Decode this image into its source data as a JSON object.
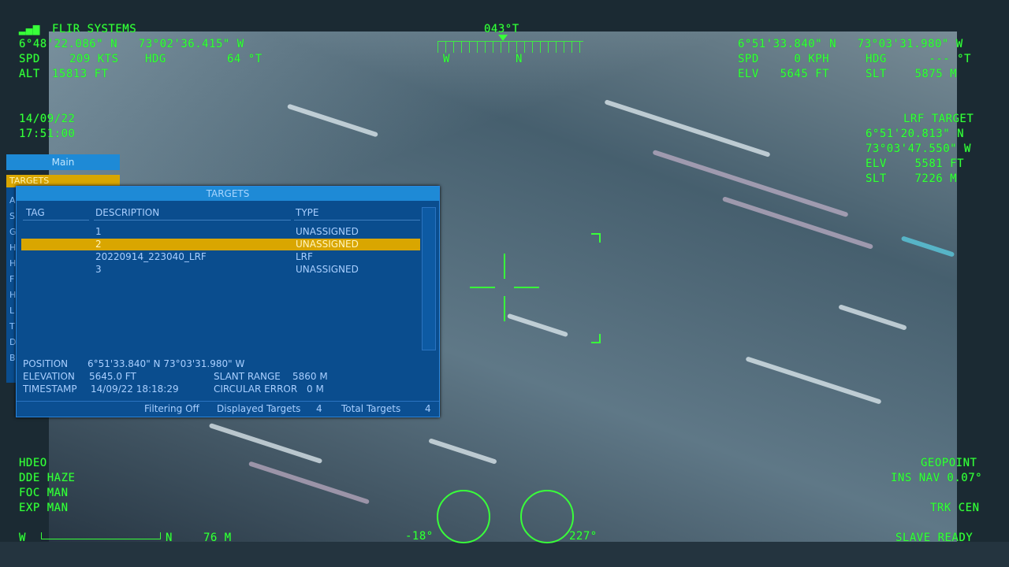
{
  "hud": {
    "brand": "FLIR SYSTEMS",
    "aircraft_lat_lon": "6°48'22.086\" N   73°02'36.415\" W",
    "spd_label": "SPD",
    "spd_value": "209 KTS",
    "hdg_label": "HDG",
    "hdg_value": "64 °T",
    "alt_label": "ALT",
    "alt_value": "15813 FT",
    "date": "14/09/22",
    "time": "17:51:00",
    "compass_heading": "043°T",
    "compass_left": "W",
    "compass_right": "N",
    "sensor_lat_lon": "6°51'33.840\" N   73°03'31.980\" W",
    "sensor_spd": "SPD     0 KPH",
    "sensor_hdg": "HDG      --- °T",
    "elv": "ELV   5645 FT",
    "slt": "SLT    5875 M",
    "lrf_title": "LRF TARGET",
    "lrf_lat": "6°51'20.813\" N",
    "lrf_lon": "73°03'47.550\" W",
    "lrf_elv": "ELV    5581 FT",
    "lrf_slt": "SLT    7226 M",
    "mode1": "HDEO",
    "mode2": "DDE HAZE",
    "mode3": "FOC MAN",
    "mode4": "EXP MAN",
    "geopoint": "GEOPOINT",
    "ins_nav": "INS NAV 0.07°",
    "trk_cen": "TRK CEN",
    "slave_ready": "SLAVE READY",
    "scale_left": "W",
    "scale_right": "N",
    "range_m": "76 M",
    "gauge1_value": "-18°",
    "gauge2_value": "227°"
  },
  "menu": {
    "main_label": "Main",
    "targets_label": "TARGETS",
    "side_letters": [
      "A",
      "S",
      "G",
      "H",
      "H",
      "F",
      "H",
      "L",
      "T",
      "D",
      "B"
    ]
  },
  "targets_panel": {
    "title": "TARGETS",
    "headers": {
      "tag": "TAG",
      "description": "DESCRIPTION",
      "type": "TYPE"
    },
    "rows": [
      {
        "description": "1",
        "type": "UNASSIGNED"
      },
      {
        "description": "2",
        "type": "UNASSIGNED"
      },
      {
        "description": "20220914_223040_LRF",
        "type": "LRF"
      },
      {
        "description": "3",
        "type": "UNASSIGNED"
      }
    ],
    "position_label": "POSITION",
    "position_value": "6°51'33.840\" N   73°03'31.980\" W",
    "elevation_label": "ELEVATION",
    "elevation_value": "5645.0 FT",
    "slant_range_label": "SLANT RANGE",
    "slant_range_value": "5860 M",
    "timestamp_label": "TIMESTAMP",
    "timestamp_value": "14/09/22 18:18:29",
    "circular_error_label": "CIRCULAR ERROR",
    "circular_error_value": "0 M",
    "filtering": "Filtering  Off",
    "displayed_targets": "Displayed Targets",
    "displayed_count": "4",
    "total_targets": "Total Targets",
    "total_count": "4"
  }
}
